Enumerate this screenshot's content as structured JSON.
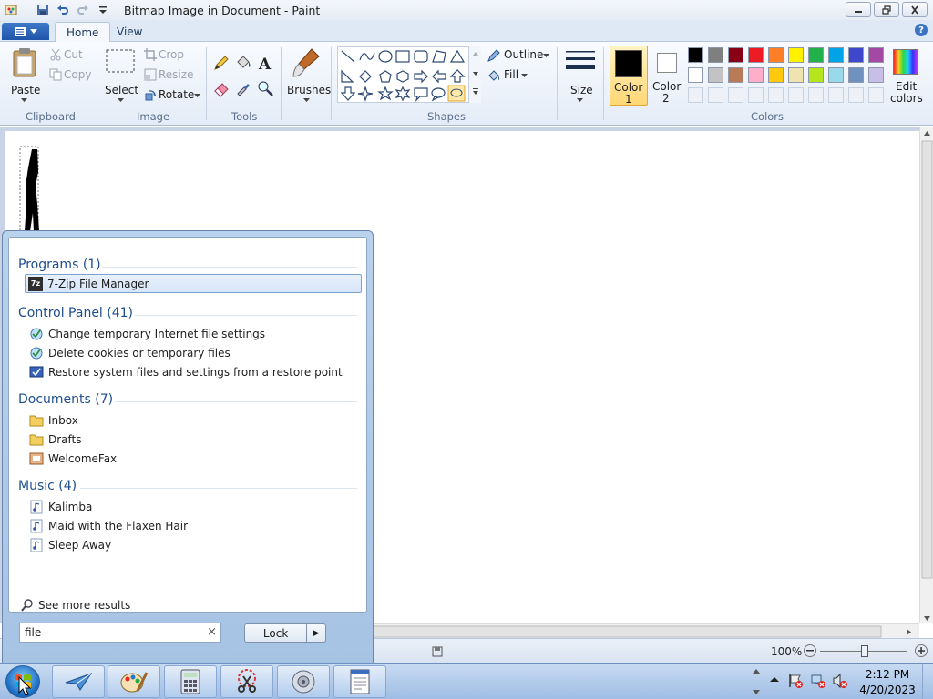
{
  "window": {
    "title": "Bitmap Image in Document - Paint"
  },
  "ribbon": {
    "tabs": [
      {
        "label": "Home"
      },
      {
        "label": "View"
      }
    ],
    "clipboard": {
      "paste": "Paste",
      "cut": "Cut",
      "copy": "Copy",
      "group": "Clipboard"
    },
    "image": {
      "select": "Select",
      "crop": "Crop",
      "resize": "Resize",
      "rotate": "Rotate",
      "group": "Image"
    },
    "tools": {
      "group": "Tools",
      "text_tool_glyph": "A"
    },
    "brushes": "Brushes",
    "shapes": {
      "outline": "Outline",
      "fill": "Fill",
      "group": "Shapes"
    },
    "size": "Size",
    "color1": {
      "line1": "Color",
      "line2": "1"
    },
    "color2": {
      "line1": "Color",
      "line2": "2"
    },
    "colors_group": "Colors",
    "edit_colors": {
      "line1": "Edit",
      "line2": "colors"
    },
    "palette_row1": [
      "#000000",
      "#7f7f7f",
      "#880015",
      "#ed1c24",
      "#ff7f27",
      "#fff200",
      "#22b14c",
      "#00a2e8",
      "#3f48cc",
      "#a349a4"
    ],
    "palette_row2": [
      "#ffffff",
      "#c3c3c3",
      "#b97a57",
      "#ffaec9",
      "#ffc90e",
      "#efe4b0",
      "#b5e61d",
      "#99d9ea",
      "#7092be",
      "#c8bfe7"
    ],
    "color1_value": "#000000",
    "color2_value": "#ffffff"
  },
  "status": {
    "zoom": "100%"
  },
  "start_menu": {
    "sections": [
      {
        "header": "Programs (1)",
        "items": [
          "7-Zip File Manager"
        ]
      },
      {
        "header": "Control Panel (41)",
        "items": [
          "Change temporary Internet file settings",
          "Delete cookies or temporary files",
          "Restore system files and settings from a restore point"
        ]
      },
      {
        "header": "Documents (7)",
        "items": [
          "Inbox",
          "Drafts",
          "WelcomeFax"
        ]
      },
      {
        "header": "Music (4)",
        "items": [
          "Kalimba",
          "Maid with the Flaxen Hair",
          "Sleep Away"
        ]
      }
    ],
    "icon_7zip": "7z",
    "see_more": "See more results",
    "search_value": "file",
    "search_clear": "×",
    "lock": "Lock",
    "lock_arrow": "▶"
  },
  "taskbar": {
    "time": "2:12 PM",
    "date": "4/20/2023"
  }
}
